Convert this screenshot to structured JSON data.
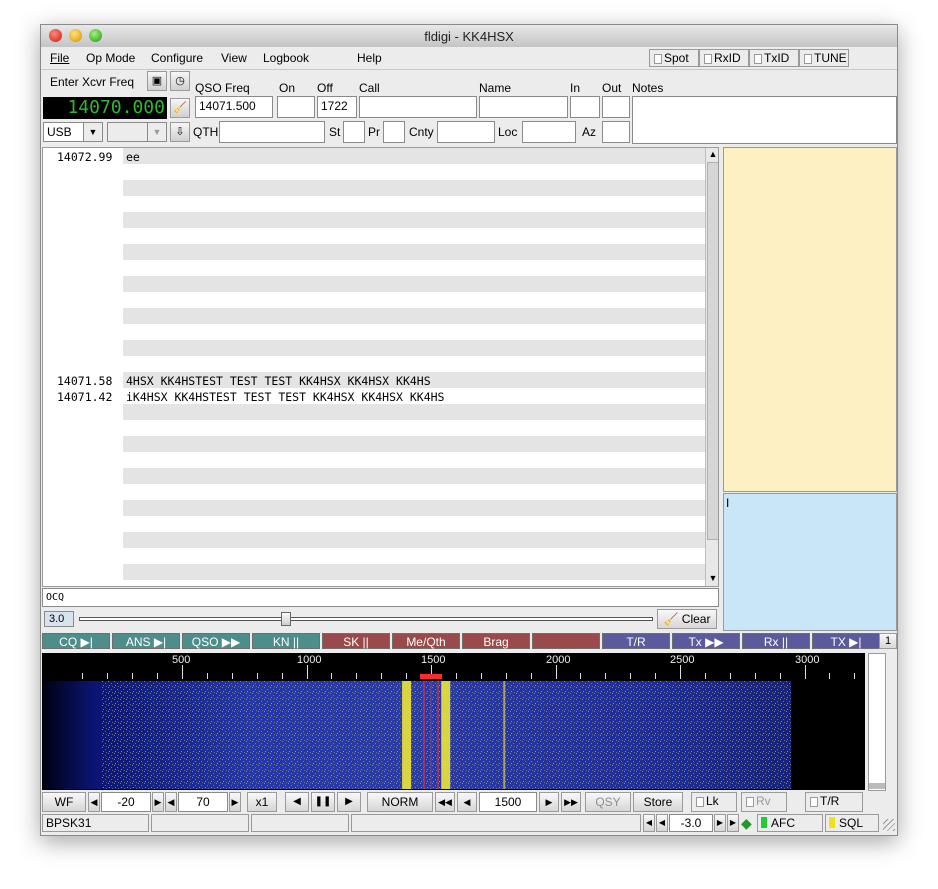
{
  "window": {
    "title": "fldigi - KK4HSX"
  },
  "menu": [
    {
      "label": "File",
      "underline": "F"
    },
    {
      "label": "Op Mode"
    },
    {
      "label": "Configure"
    },
    {
      "label": "View"
    },
    {
      "label": "Logbook"
    },
    {
      "label": "Help"
    }
  ],
  "menu_toggles": {
    "spot": "Spot",
    "rxid": "RxID",
    "txid": "TxID",
    "tune": "TUNE"
  },
  "xcvr": {
    "enter_label": "Enter Xcvr Freq",
    "freq_display": "14070.000",
    "mode": "USB",
    "mode_arrow": "▼",
    "bw": "",
    "bw_arrow": "▼"
  },
  "log_labels": {
    "qso_freq": "QSO Freq",
    "on": "On",
    "off": "Off",
    "call": "Call",
    "name": "Name",
    "in": "In",
    "out": "Out",
    "notes": "Notes",
    "qth": "QTH",
    "st": "St",
    "pr": "Pr",
    "cnty": "Cnty",
    "loc": "Loc",
    "az": "Az"
  },
  "log_values": {
    "qso_freq": "14071.500",
    "on": "",
    "off": "1722",
    "call": "",
    "name": "",
    "in": "",
    "out": "",
    "notes": "",
    "qth": "",
    "st": "",
    "pr": "",
    "cnty": "",
    "loc": "",
    "az": ""
  },
  "rx": {
    "lines": [
      {
        "freq": "14072.99",
        "text": "ee"
      },
      {
        "freq": "14071.58",
        "text": "4HSX KK4HSTEST TEST TEST KK4HSX KK4HSX KK4HS"
      },
      {
        "freq": "14071.42",
        "text": "iK4HSX KK4HSTEST TEST TEST KK4HSX KK4HSX KK4HS"
      }
    ],
    "scroll_up": "▲",
    "scroll_down": "▼"
  },
  "tx": {
    "cursor": "I",
    "input": "OCQ"
  },
  "squelch": {
    "value": "3.0",
    "level": 0.35
  },
  "clear_label": "Clear",
  "macros": [
    {
      "label": "CQ ▶|",
      "color": "#4e8e8a"
    },
    {
      "label": "ANS ▶|",
      "color": "#4e8e8a"
    },
    {
      "label": "QSO ▶▶",
      "color": "#4e8e8a"
    },
    {
      "label": "KN ||",
      "color": "#4e8e8a"
    },
    {
      "label": "SK ||",
      "color": "#9a4a4a"
    },
    {
      "label": "Me/Qth",
      "color": "#9a4a4a"
    },
    {
      "label": "Brag",
      "color": "#9a4a4a"
    },
    {
      "label": "",
      "color": "#9a4a4a"
    },
    {
      "label": "T/R",
      "color": "#5a5a9c"
    },
    {
      "label": "Tx ▶▶",
      "color": "#5a5a9c"
    },
    {
      "label": "Rx ||",
      "color": "#5a5a9c"
    },
    {
      "label": "TX ▶|",
      "color": "#5a5a9c"
    }
  ],
  "macro_page": "1",
  "waterfall": {
    "ticks": [
      "500",
      "1000",
      "1500",
      "2000",
      "2500",
      "3000"
    ],
    "signals_hz": [
      1400,
      1500,
      1525,
      1750
    ],
    "cursor_hz": 1500
  },
  "wf_controls": {
    "wf": "WF",
    "ref": "-20",
    "range": "70",
    "zoom": "x1",
    "pause": "||",
    "norm": "NORM",
    "carrier": "1500",
    "qsy": "QSY",
    "store": "Store",
    "lk": "Lk",
    "rv": "Rv",
    "tr": "T/R",
    "left": "◀",
    "right": "▶",
    "fast_left": "◀◀",
    "fast_right": "▶▶",
    "pause_icon": "❚❚"
  },
  "status": {
    "mode": "BPSK31",
    "s2": "",
    "s3": "",
    "s4": "",
    "afc_offset": "-3.0",
    "afc": "AFC",
    "sql": "SQL",
    "led_afc": "#1fcf2f",
    "led_sql": "#f0e21a"
  }
}
